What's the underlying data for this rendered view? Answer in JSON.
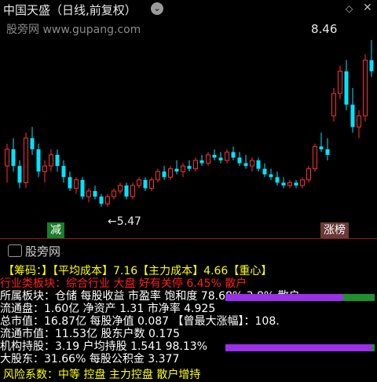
{
  "header": {
    "title": "中国天盛（日线,前复权）",
    "dropdown_icon": "chevron-down-icon",
    "watermark": "股旁网 www.gupang.com",
    "window_controls": [
      "◇",
      "✕"
    ]
  },
  "chart": {
    "price_high": "8.46",
    "price_low": "←5.47",
    "tag_left": "减",
    "tag_right": "涨榜",
    "up_color": "#ff3030",
    "down_color": "#00e5ff",
    "candles": [
      [
        6.2,
        6.6,
        5.9,
        6.5
      ],
      [
        6.5,
        6.7,
        6.1,
        6.2
      ],
      [
        6.2,
        6.3,
        5.8,
        5.9
      ],
      [
        5.9,
        6.8,
        5.8,
        6.7
      ],
      [
        6.7,
        6.9,
        6.4,
        6.5
      ],
      [
        6.5,
        6.6,
        6.0,
        6.1
      ],
      [
        6.1,
        6.3,
        5.9,
        6.2
      ],
      [
        6.2,
        6.5,
        6.1,
        6.4
      ],
      [
        6.4,
        6.5,
        6.1,
        6.2
      ],
      [
        6.2,
        6.3,
        5.9,
        6.0
      ],
      [
        6.0,
        6.1,
        5.75,
        5.8
      ],
      [
        5.8,
        6.0,
        5.7,
        5.95
      ],
      [
        5.95,
        6.0,
        5.6,
        5.65
      ],
      [
        5.65,
        5.8,
        5.55,
        5.75
      ],
      [
        5.75,
        5.85,
        5.6,
        5.65
      ],
      [
        5.65,
        5.7,
        5.47,
        5.52
      ],
      [
        5.52,
        5.7,
        5.47,
        5.65
      ],
      [
        5.65,
        5.8,
        5.6,
        5.75
      ],
      [
        5.75,
        5.9,
        5.7,
        5.85
      ],
      [
        5.85,
        5.9,
        5.6,
        5.65
      ],
      [
        5.65,
        5.9,
        5.6,
        5.85
      ],
      [
        5.85,
        6.0,
        5.8,
        5.95
      ],
      [
        5.95,
        6.0,
        5.75,
        5.8
      ],
      [
        5.8,
        6.0,
        5.75,
        5.95
      ],
      [
        5.95,
        6.15,
        5.9,
        6.1
      ],
      [
        6.1,
        6.2,
        5.95,
        6.0
      ],
      [
        6.0,
        6.2,
        5.95,
        6.15
      ],
      [
        6.15,
        6.3,
        6.05,
        6.1
      ],
      [
        6.1,
        6.25,
        6.0,
        6.2
      ],
      [
        6.2,
        6.3,
        6.1,
        6.15
      ],
      [
        6.15,
        6.35,
        6.1,
        6.3
      ],
      [
        6.3,
        6.4,
        6.2,
        6.25
      ],
      [
        6.25,
        6.45,
        6.2,
        6.4
      ],
      [
        6.4,
        6.5,
        6.3,
        6.35
      ],
      [
        6.35,
        6.45,
        6.25,
        6.3
      ],
      [
        6.3,
        6.5,
        6.25,
        6.45
      ],
      [
        6.45,
        6.55,
        6.3,
        6.35
      ],
      [
        6.35,
        6.45,
        6.2,
        6.25
      ],
      [
        6.25,
        6.4,
        6.15,
        6.2
      ],
      [
        6.2,
        6.35,
        6.1,
        6.3
      ],
      [
        6.3,
        6.35,
        6.1,
        6.15
      ],
      [
        6.15,
        6.25,
        6.0,
        6.05
      ],
      [
        6.05,
        6.15,
        5.95,
        6.0
      ],
      [
        6.0,
        6.1,
        5.85,
        5.9
      ],
      [
        5.9,
        6.0,
        5.8,
        5.85
      ],
      [
        5.85,
        5.95,
        5.8,
        5.9
      ],
      [
        5.9,
        5.95,
        5.8,
        5.85
      ],
      [
        5.85,
        6.0,
        5.8,
        5.95
      ],
      [
        5.95,
        6.2,
        5.9,
        6.15
      ],
      [
        6.15,
        6.6,
        6.1,
        6.55
      ],
      [
        6.55,
        6.8,
        6.45,
        6.5
      ],
      [
        6.5,
        6.7,
        6.3,
        6.4
      ],
      [
        7.1,
        7.6,
        7.0,
        7.5
      ],
      [
        7.5,
        8.0,
        7.4,
        7.9
      ],
      [
        7.9,
        8.1,
        7.2,
        7.3
      ],
      [
        7.3,
        7.6,
        6.8,
        6.9
      ],
      [
        6.9,
        7.2,
        6.7,
        7.1
      ],
      [
        7.1,
        8.2,
        7.0,
        8.1
      ],
      [
        8.1,
        8.46,
        7.8,
        7.9
      ]
    ]
  },
  "indicator_panel": {
    "logo": "股旁网",
    "lines": [
      {
        "text": "【筹码：】【平均成本】7.16【主力成本】4.66【重心】",
        "color": "#ffff00"
      },
      {
        "text": "行业类板块：综合行业  大盘  好有关停  6.45%  散户",
        "color": "#ff1e1e"
      },
      {
        "text": "所属板块：仓储  每股收益  市盈率  饱和度  78.68%  3.8%  散户",
        "color": "#ffffff"
      },
      {
        "text": "流通盘：1.60亿  净资产  1.31  市净率  4.925",
        "color": "#ffffff"
      },
      {
        "text": "总市值：16.87亿  每股净值  0.087  【曾最大涨幅】：108.",
        "color": "#ffffff"
      },
      {
        "text": "流通市值：11.53亿  股东户数  0.175",
        "color": "#ffffff"
      },
      {
        "text": "机构持股：3.19  户均持股  1.541  98.13%",
        "color": "#ffffff"
      },
      {
        "text": "大股东：31.66%  每股公积金  3.377",
        "color": "#ffffff"
      },
      {
        "text": "风险系数：中等  控盘  主力控盘  散户增持",
        "color": "#ffff00"
      }
    ],
    "bars": [
      {
        "label": "78.68%",
        "value": 0.7868,
        "color": "#9a30e8",
        "rest": "#1f8f2f"
      },
      {
        "label": "98.13%",
        "value": 0.9813,
        "color": "#9a30e8",
        "rest": "#1f8f2f"
      }
    ]
  }
}
